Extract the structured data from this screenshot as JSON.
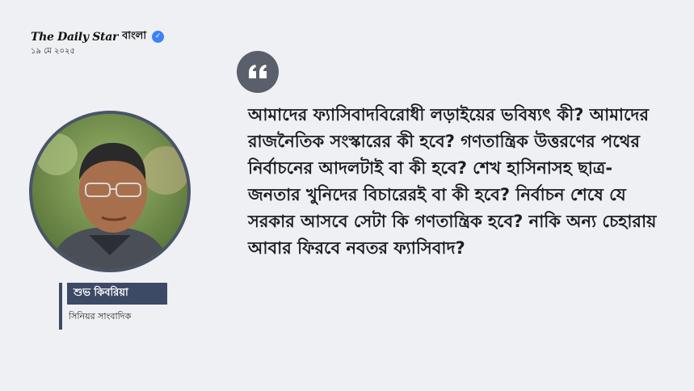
{
  "brand": {
    "logo_text": "The Daily Star",
    "bangla_text": "বাংলা",
    "verified_icon": "check-badge-icon"
  },
  "date": "১৯ মে ২০২৫",
  "quote": {
    "icon": "quote-mark-icon",
    "text": "আমাদের ফ্যাসিবাদবিরোধী লড়াইয়ের ভবিষ্যৎ কী? আমাদের রাজনৈতিক সংস্কারের কী হবে? গণতান্ত্রিক উত্তরণের পথের নির্বাচনের আদলটাই বা কী হবে? শেখ হাসিনাসহ ছাত্র-জনতার খুনিদের বিচারেরই বা কী হবে? নির্বাচন শেষে যে সরকার আসবে সেটা কি গণতান্ত্রিক হবে? নাকি অন্য চেহারায় আবার ফিরবে নবতর ফ্যাসিবাদ?"
  },
  "author": {
    "name": "শুভ কিবরিয়া",
    "role": "সিনিয়র সাংবাদিক"
  },
  "colors": {
    "background": "#eef0f3",
    "accent": "#3d4a66",
    "quote_badge": "#5a5f6b",
    "verified": "#3b82f6"
  }
}
